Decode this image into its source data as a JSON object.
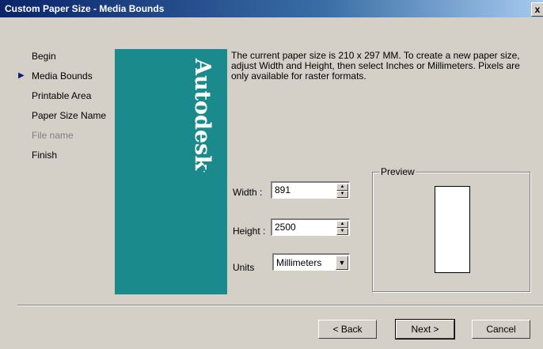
{
  "window": {
    "title": "Custom Paper Size - Media Bounds",
    "close_label": "x"
  },
  "steps": [
    {
      "label": "Begin",
      "current": false,
      "enabled": true
    },
    {
      "label": "Media Bounds",
      "current": true,
      "enabled": true
    },
    {
      "label": "Printable Area",
      "current": false,
      "enabled": true
    },
    {
      "label": "Paper Size Name",
      "current": false,
      "enabled": true
    },
    {
      "label": "File name",
      "current": false,
      "enabled": false
    },
    {
      "label": "Finish",
      "current": false,
      "enabled": true
    }
  ],
  "banner": {
    "brand": "Autodesk",
    "brand_mark": ".",
    "color": "#1b8a8c"
  },
  "description": "The current paper size is 210 x 297 MM. To create a new paper size, adjust Width and Height, then select Inches or Millimeters. Pixels are only available for raster formats.",
  "form": {
    "width_label": "Width :",
    "width_value": "891",
    "height_label": "Height :",
    "height_value": "2500",
    "units_label": "Units",
    "units_value": "Millimeters"
  },
  "preview": {
    "label": "Preview"
  },
  "buttons": {
    "back": "< Back",
    "next": "Next >",
    "cancel": "Cancel"
  }
}
